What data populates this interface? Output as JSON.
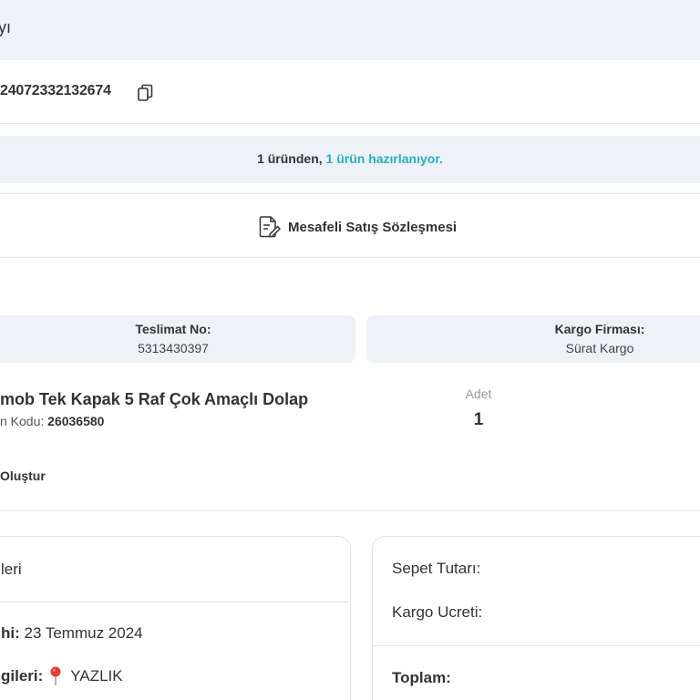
{
  "header": {
    "title": "yı"
  },
  "order": {
    "number": "24072332132674",
    "copy_icon": "copy-icon"
  },
  "status": {
    "prefix": "1 üründen,",
    "highlight": "1 ürün hazırlanıyor.",
    "highlight_color": "#23b0c5"
  },
  "contract": {
    "label": "Mesafeli Satış Sözleşmesi",
    "icon": "document-edit-icon"
  },
  "delivery": {
    "label": "Teslimat No:",
    "value": "5313430397"
  },
  "cargo": {
    "label": "Kargo Firması:",
    "value": "Sürat Kargo"
  },
  "product": {
    "name": "mob Tek Kapak 5 Raf Çok Amaçlı Dolap",
    "code_label": "n Kodu:",
    "code_value": "26036580",
    "qty_label": "Adet",
    "qty_value": "1",
    "action": "Oluştur"
  },
  "delivery_card": {
    "title": "leri",
    "date_label": "hi:",
    "date_value": "23 Temmuz 2024",
    "address_label": "gileri:",
    "address_value": "YAZLIK",
    "pin_icon": "map-pin-icon"
  },
  "summary_card": {
    "basket_label": "Sepet Tutarı:",
    "shipping_label": "Kargo Ucreti:",
    "total_label": "Toplam:"
  },
  "colors": {
    "header_bg": "#eef2f8",
    "status_bg": "#eef2f7",
    "accent": "#23b0c5"
  }
}
